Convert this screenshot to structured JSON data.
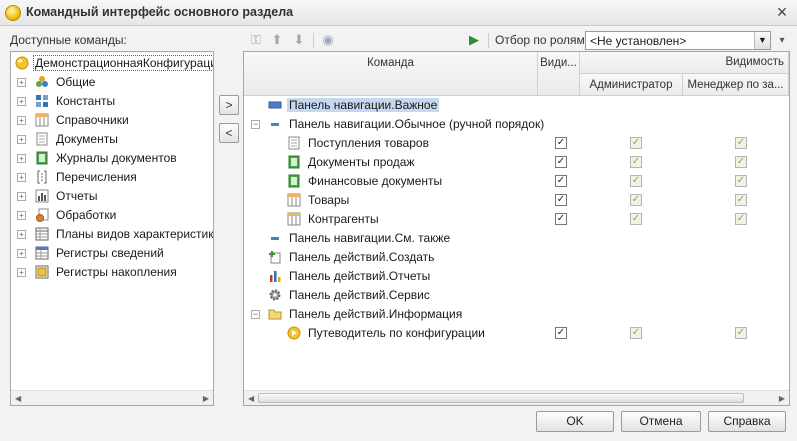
{
  "window": {
    "title": "Командный интерфейс основного раздела"
  },
  "left": {
    "label": "Доступные команды:",
    "root": "ДемонстрационнаяКонфигурация",
    "items": [
      {
        "label": "Общие",
        "icon": "common-icon"
      },
      {
        "label": "Константы",
        "icon": "constants-icon"
      },
      {
        "label": "Справочники",
        "icon": "catalogs-icon"
      },
      {
        "label": "Документы",
        "icon": "documents-icon"
      },
      {
        "label": "Журналы документов",
        "icon": "journals-icon"
      },
      {
        "label": "Перечисления",
        "icon": "enums-icon"
      },
      {
        "label": "Отчеты",
        "icon": "reports-icon"
      },
      {
        "label": "Обработки",
        "icon": "processing-icon"
      },
      {
        "label": "Планы видов характеристик",
        "icon": "chart-types-icon"
      },
      {
        "label": "Регистры сведений",
        "icon": "info-registers-icon"
      },
      {
        "label": "Регистры накопления",
        "icon": "accum-registers-icon"
      }
    ]
  },
  "middle": {
    "add": ">",
    "remove": "<"
  },
  "toolbar": {
    "role_label": "Отбор по ролям:",
    "role_value": "<Не установлен>"
  },
  "table": {
    "headers": {
      "command": "Команда",
      "visibility_short": "Види...",
      "visibility": "Видимость",
      "admin": "Администратор",
      "manager": "Менеджер по за..."
    },
    "rows": [
      {
        "label": "Панель навигации.Важное",
        "selected": true,
        "checks": null
      },
      {
        "label": "Панель навигации.Обычное (ручной порядок)",
        "checks": null
      },
      {
        "label": "Поступления товаров",
        "checks": [
          true,
          true,
          true
        ]
      },
      {
        "label": "Документы продаж",
        "checks": [
          true,
          true,
          true
        ]
      },
      {
        "label": "Финансовые документы",
        "checks": [
          true,
          true,
          true
        ]
      },
      {
        "label": "Товары",
        "checks": [
          true,
          true,
          true
        ]
      },
      {
        "label": "Контрагенты",
        "checks": [
          true,
          true,
          true
        ]
      },
      {
        "label": "Панель навигации.См. также",
        "checks": null
      },
      {
        "label": "Панель действий.Создать",
        "checks": null
      },
      {
        "label": "Панель действий.Отчеты",
        "checks": null
      },
      {
        "label": "Панель действий.Сервис",
        "checks": null
      },
      {
        "label": "Панель действий.Информация",
        "checks": null
      },
      {
        "label": "Путеводитель по конфигурации",
        "checks": [
          true,
          true,
          true
        ]
      }
    ]
  },
  "buttons": {
    "ok": "OK",
    "cancel": "Отмена",
    "help": "Справка"
  }
}
